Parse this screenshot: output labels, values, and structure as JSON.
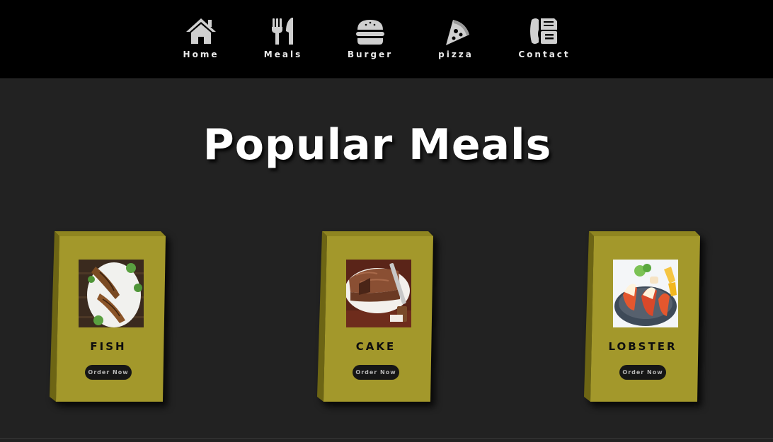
{
  "nav": {
    "items": [
      {
        "label": "Home",
        "icon": "home-icon"
      },
      {
        "label": "Meals",
        "icon": "utensils-icon"
      },
      {
        "label": "Burger",
        "icon": "burger-icon"
      },
      {
        "label": "pizza",
        "icon": "pizza-slice-icon"
      },
      {
        "label": "Contact",
        "icon": "phone-fax-icon"
      }
    ]
  },
  "main": {
    "title": "Popular Meals",
    "cards": [
      {
        "name": "FISH",
        "button": "Order Now",
        "image": "grilled-fish-photo"
      },
      {
        "name": "CAKE",
        "button": "Order Now",
        "image": "chocolate-cake-photo"
      },
      {
        "name": "LOBSTER",
        "button": "Order Now",
        "image": "lobster-tails-photo"
      }
    ]
  },
  "colors": {
    "navbar": "#000000",
    "background": "#222222",
    "card": "#a3982b",
    "card_side": "#6d6514",
    "button": "#161616"
  }
}
